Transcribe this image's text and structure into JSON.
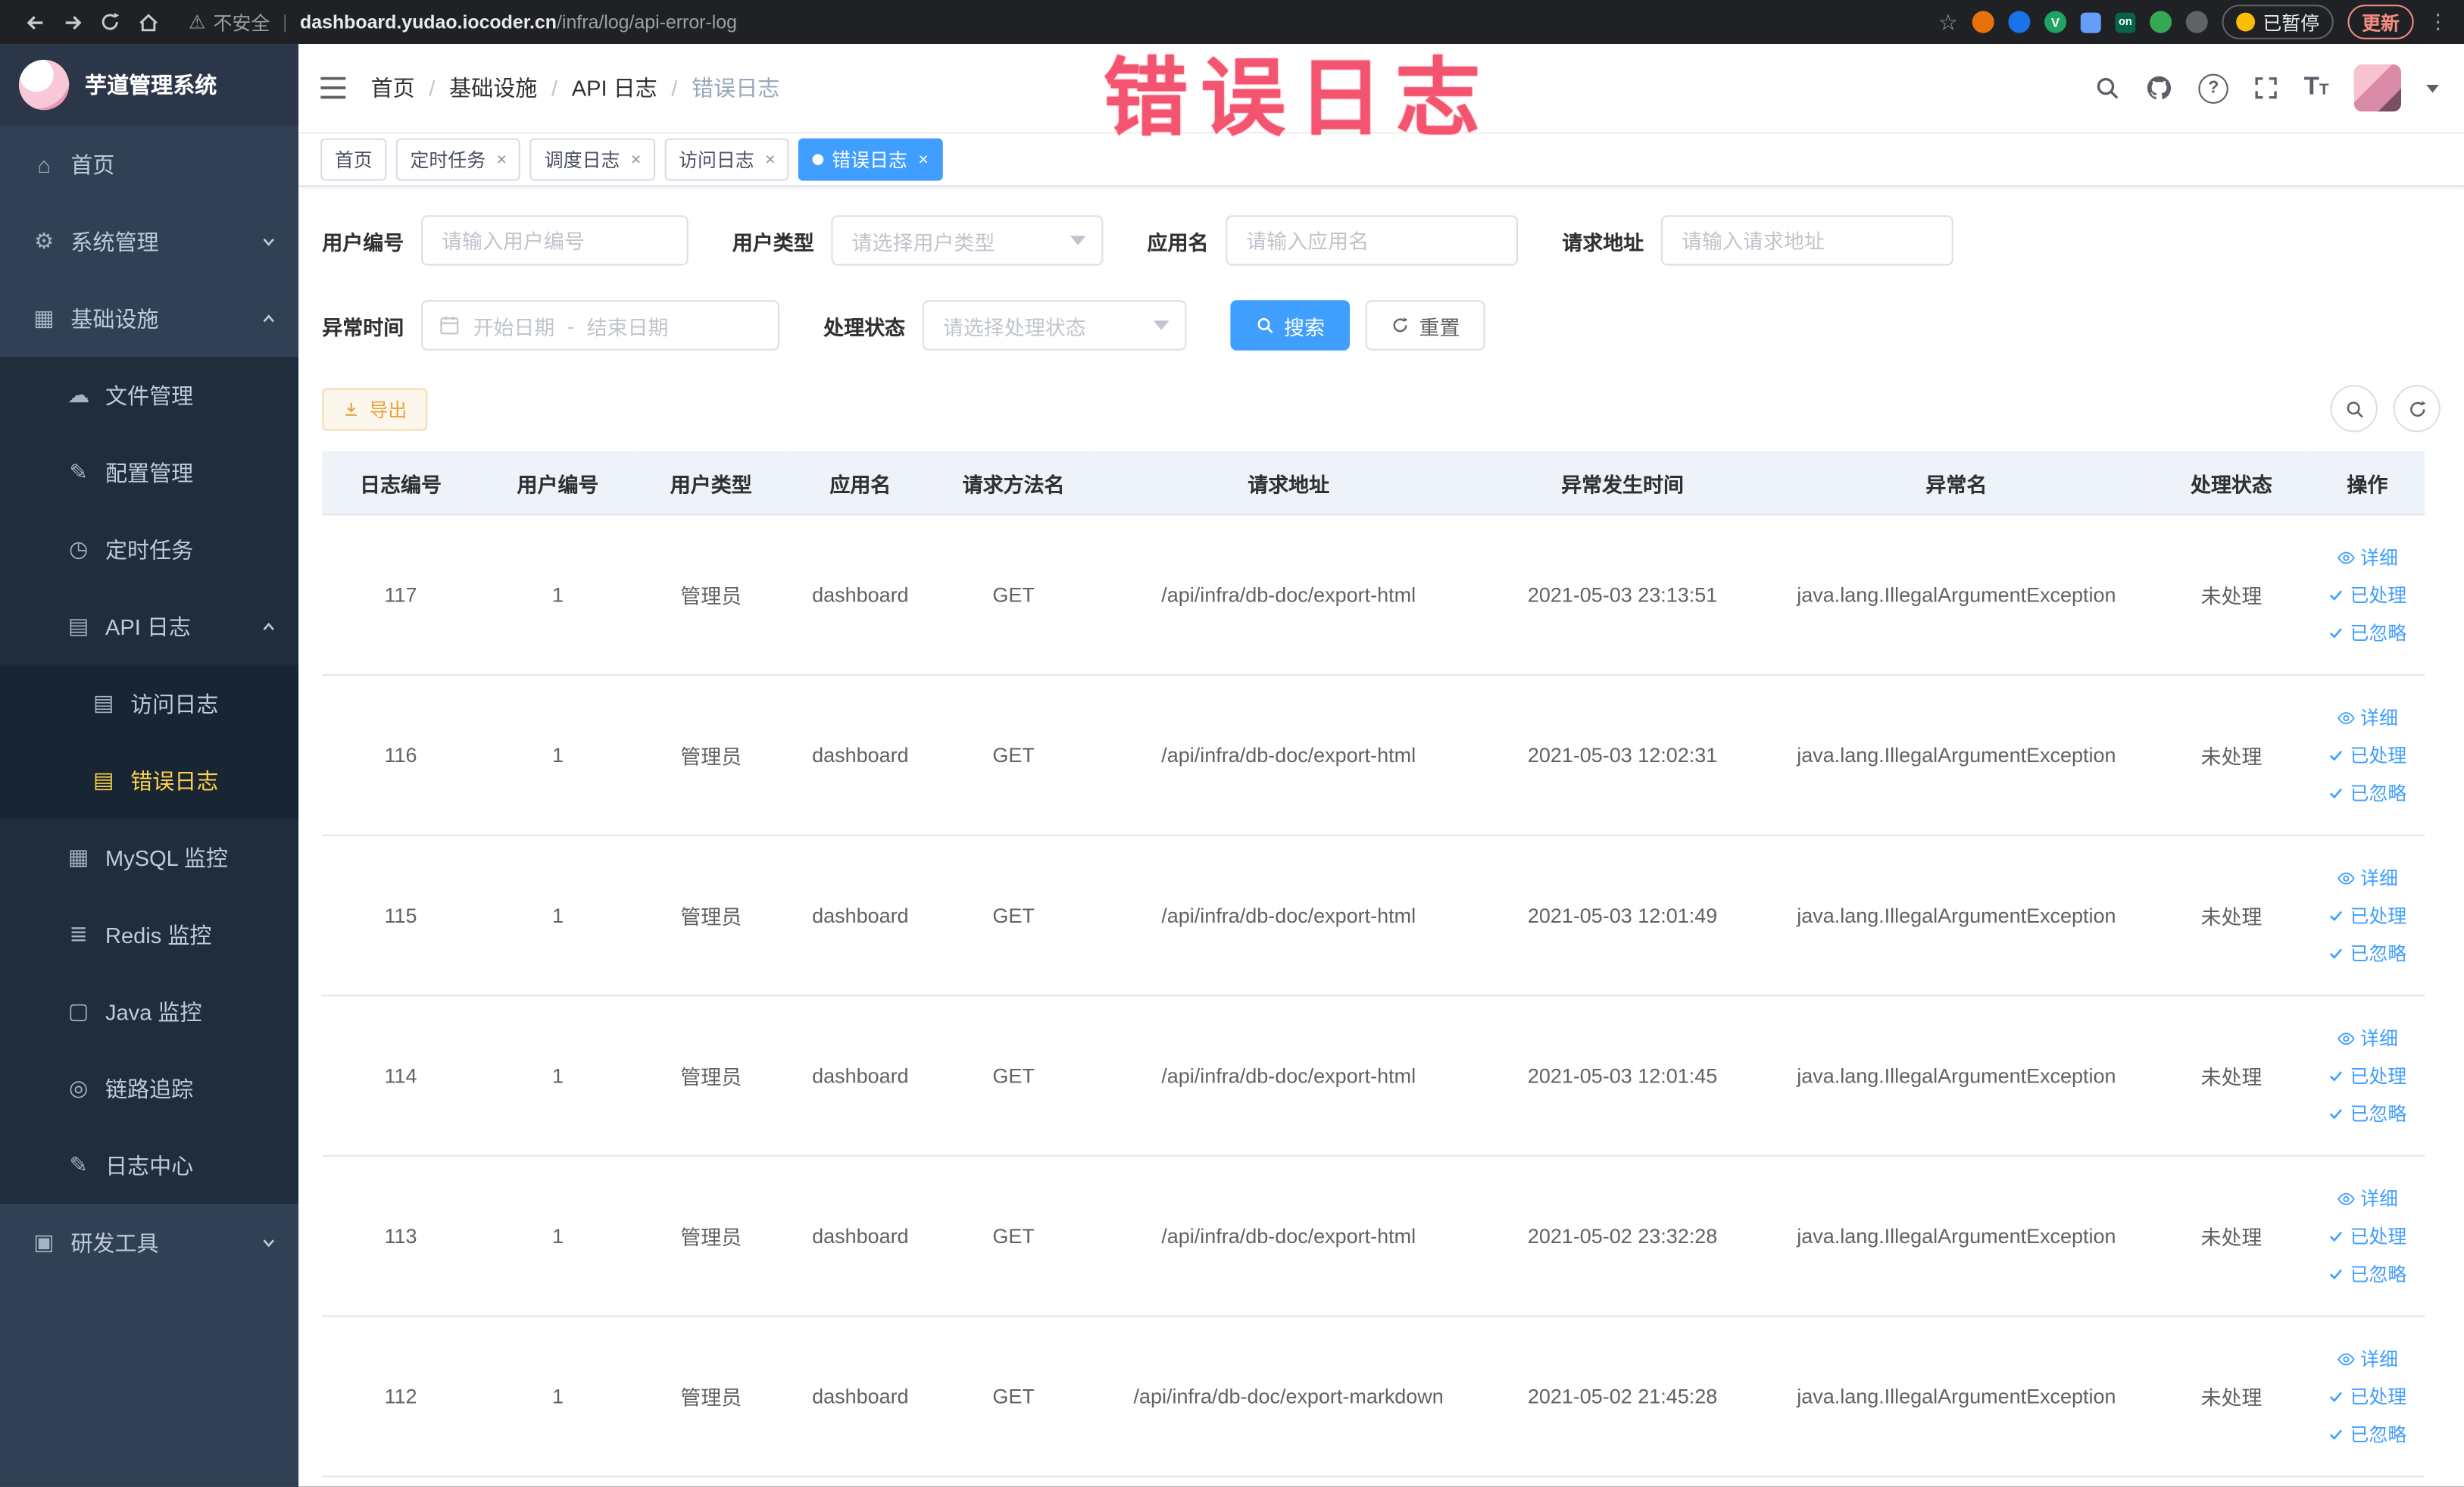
{
  "browser": {
    "security_label": "不安全",
    "url_host": "dashboard.yudao.iocoder.cn",
    "url_path": "/infra/log/api-error-log",
    "paused_chip": "已暂停",
    "update_chip": "更新"
  },
  "watermark": {
    "text": "错误日志"
  },
  "sidebar": {
    "logo_title": "芋道管理系统",
    "items": [
      {
        "label": "首页"
      },
      {
        "label": "系统管理"
      },
      {
        "label": "基础设施"
      },
      {
        "label": "文件管理"
      },
      {
        "label": "配置管理"
      },
      {
        "label": "定时任务"
      },
      {
        "label": "API 日志"
      },
      {
        "label": "访问日志"
      },
      {
        "label": "错误日志",
        "active": true
      },
      {
        "label": "MySQL 监控"
      },
      {
        "label": "Redis 监控"
      },
      {
        "label": "Java 监控"
      },
      {
        "label": "链路追踪"
      },
      {
        "label": "日志中心"
      },
      {
        "label": "研发工具"
      }
    ]
  },
  "header": {
    "breadcrumb": [
      "首页",
      "基础设施",
      "API 日志",
      "错误日志"
    ]
  },
  "tabs": [
    {
      "label": "首页"
    },
    {
      "label": "定时任务"
    },
    {
      "label": "调度日志"
    },
    {
      "label": "访问日志"
    },
    {
      "label": "错误日志",
      "active": true
    }
  ],
  "filters": {
    "user_id": {
      "label": "用户编号",
      "placeholder": "请输入用户编号"
    },
    "user_type": {
      "label": "用户类型",
      "placeholder": "请选择用户类型"
    },
    "app_name": {
      "label": "应用名",
      "placeholder": "请输入应用名"
    },
    "request_url": {
      "label": "请求地址",
      "placeholder": "请输入请求地址"
    },
    "exception_time": {
      "label": "异常时间",
      "start_placeholder": "开始日期",
      "separator": "-",
      "end_placeholder": "结束日期"
    },
    "process_status": {
      "label": "处理状态",
      "placeholder": "请选择处理状态"
    },
    "search_button": "搜索",
    "reset_button": "重置"
  },
  "toolbar": {
    "export_button": "导出"
  },
  "table": {
    "headers": [
      "日志编号",
      "用户编号",
      "用户类型",
      "应用名",
      "请求方法名",
      "请求地址",
      "异常发生时间",
      "异常名",
      "处理状态",
      "操作"
    ],
    "actions": [
      "详细",
      "已处理",
      "已忽略"
    ],
    "rows": [
      {
        "id": "117",
        "user_id": "1",
        "user_type": "管理员",
        "app": "dashboard",
        "method": "GET",
        "url": "/api/infra/db-doc/export-html",
        "time": "2021-05-03 23:13:51",
        "exception": "java.lang.IllegalArgumentException",
        "status": "未处理"
      },
      {
        "id": "116",
        "user_id": "1",
        "user_type": "管理员",
        "app": "dashboard",
        "method": "GET",
        "url": "/api/infra/db-doc/export-html",
        "time": "2021-05-03 12:02:31",
        "exception": "java.lang.IllegalArgumentException",
        "status": "未处理"
      },
      {
        "id": "115",
        "user_id": "1",
        "user_type": "管理员",
        "app": "dashboard",
        "method": "GET",
        "url": "/api/infra/db-doc/export-html",
        "time": "2021-05-03 12:01:49",
        "exception": "java.lang.IllegalArgumentException",
        "status": "未处理"
      },
      {
        "id": "114",
        "user_id": "1",
        "user_type": "管理员",
        "app": "dashboard",
        "method": "GET",
        "url": "/api/infra/db-doc/export-html",
        "time": "2021-05-03 12:01:45",
        "exception": "java.lang.IllegalArgumentException",
        "status": "未处理"
      },
      {
        "id": "113",
        "user_id": "1",
        "user_type": "管理员",
        "app": "dashboard",
        "method": "GET",
        "url": "/api/infra/db-doc/export-html",
        "time": "2021-05-02 23:32:28",
        "exception": "java.lang.IllegalArgumentException",
        "status": "未处理"
      },
      {
        "id": "112",
        "user_id": "1",
        "user_type": "管理员",
        "app": "dashboard",
        "method": "GET",
        "url": "/api/infra/db-doc/export-markdown",
        "time": "2021-05-02 21:45:28",
        "exception": "java.lang.IllegalArgumentException",
        "status": "未处理"
      }
    ]
  },
  "colors": {
    "primary": "#409eff",
    "sidebar_bg": "#304156",
    "active_menu_text": "#ffd04b",
    "warning": "#e6a23c",
    "watermark": "#f4546f"
  }
}
